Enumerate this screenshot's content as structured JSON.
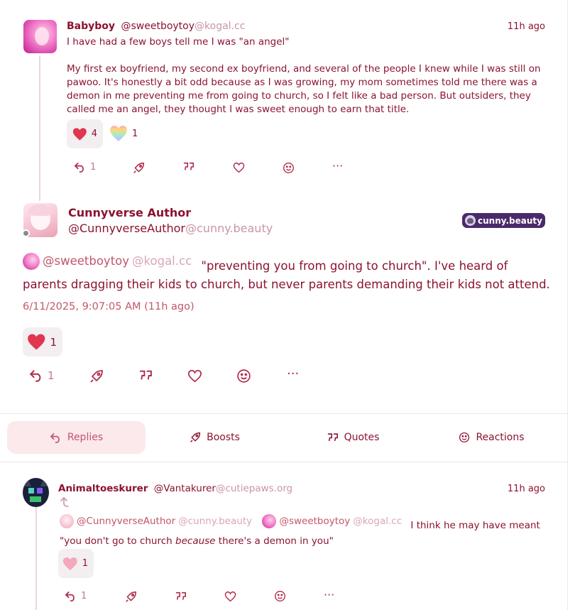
{
  "post1": {
    "display_name": "Babyboy",
    "handle": "@sweetboytoy",
    "domain": "@kogal.cc",
    "time": "11h ago",
    "line1": "I have had a few boys tell me I was \"an angel\"",
    "para2_l1": "My first ex boyfriend, my second ex boyfriend, and several of the people I knew while I was still on",
    "para2_l2": "pawoo. It's honestly a bit odd because as I was growing, my mom sometimes told me there was a",
    "para2_l3": "demon in me preventing me from going to church, so I felt like a bad person. But outsiders, they",
    "para2_l4": "called me an angel, they thought I was sweet enough to earn that title.",
    "reactions": [
      {
        "icon": "heart-emoji-icon",
        "count": "4"
      },
      {
        "icon": "rainbow-heart-emoji-icon",
        "count": "1"
      }
    ],
    "actions": {
      "reply_count": "1",
      "more": "···"
    }
  },
  "main": {
    "display_name": "Cunnyverse Author",
    "handle": "@CunnyverseAuthor",
    "domain": "@cunny.beauty",
    "instance_badge": "cunny.beauty",
    "mention_handle": "@sweetboytoy",
    "mention_domain": "@kogal.cc",
    "text_l1": "\"preventing you from going to church\". I've heard of",
    "text_l2": "parents dragging their kids to church, but never parents demanding their kids not attend.",
    "timestamp": "6/11/2025, 9:07:05 AM (11h ago)",
    "reaction_count": "1",
    "actions": {
      "reply_count": "1",
      "more": "···"
    }
  },
  "tabs": [
    {
      "label": "Replies",
      "icon": "reply-icon"
    },
    {
      "label": "Boosts",
      "icon": "rocket-icon"
    },
    {
      "label": "Quotes",
      "icon": "quote-icon"
    },
    {
      "label": "Reactions",
      "icon": "smile-icon"
    }
  ],
  "reply": {
    "display_name": "Animaltoeskurer",
    "handle": "@Vantakurer",
    "domain": "@cutiepaws.org",
    "time": "11h ago",
    "mention1_handle": "@CunnyverseAuthor",
    "mention1_domain": "@cunny.beauty",
    "mention2_handle": "@sweetboytoy",
    "mention2_domain": "@kogal.cc",
    "text_l1": "I think he may have meant",
    "text_l2_a": "\"you don't go to church ",
    "text_l2_em": "because",
    "text_l2_b": " there's a demon in you\"",
    "reaction_count": "1",
    "actions": {
      "reply_count": "1",
      "more": "···"
    }
  },
  "colors": {
    "accent": "#8b1330",
    "muted": "#c995a3",
    "tab_active_bg": "#fbe9ec",
    "heart": "#e0364f",
    "badge_bg": "#4b2a6b"
  }
}
